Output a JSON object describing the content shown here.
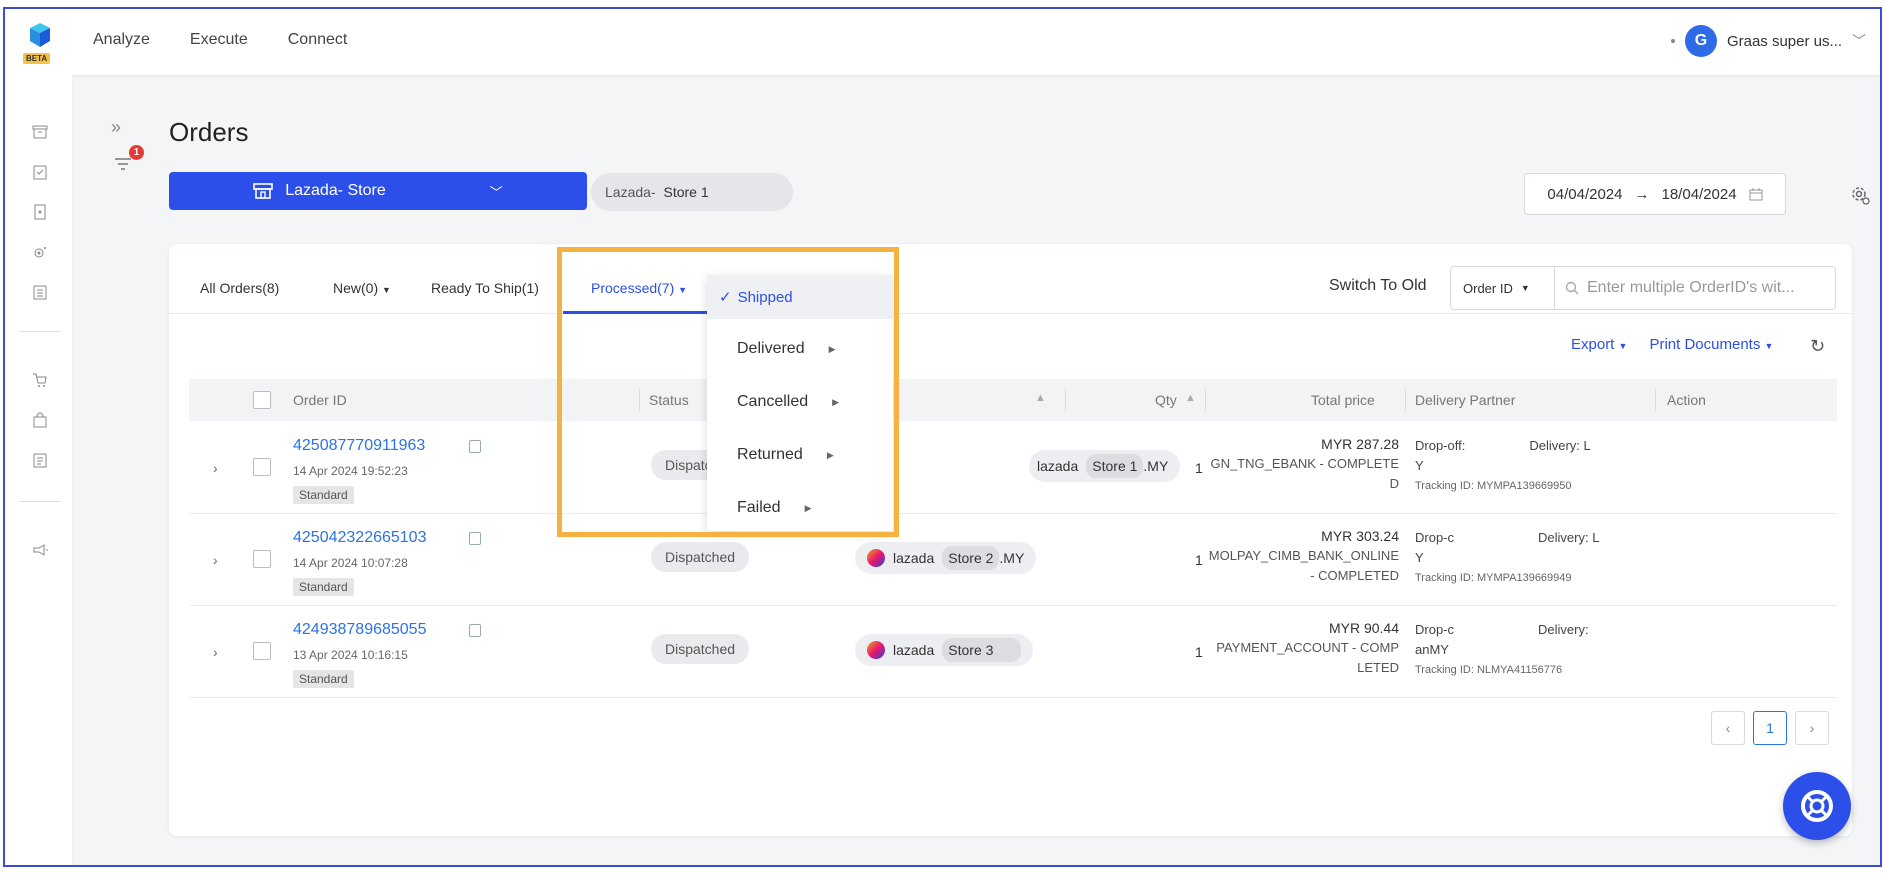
{
  "app": {
    "beta_label": "BETA"
  },
  "topnav": {
    "items": [
      "Analyze",
      "Execute",
      "Connect"
    ]
  },
  "user": {
    "avatar_initial": "G",
    "name": "Graas super us..."
  },
  "page": {
    "title": "Orders"
  },
  "filter": {
    "badge_count": "1"
  },
  "store_selector": {
    "label": "Lazada- Store",
    "chip_label": "Lazada-",
    "chip_store": "Store 1"
  },
  "date_range": {
    "start": "04/04/2024",
    "arrow": "→",
    "end": "18/04/2024"
  },
  "tabs": [
    {
      "label": "All Orders(8)"
    },
    {
      "label": "New(0)"
    },
    {
      "label": "Ready To Ship(1)"
    },
    {
      "label": "Processed(7)"
    }
  ],
  "processed_dropdown": {
    "items": [
      "Shipped",
      "Delivered",
      "Cancelled",
      "Returned",
      "Failed"
    ],
    "selected": "Shipped"
  },
  "toolbar": {
    "switch_old": "Switch To Old",
    "search_type": "Order ID",
    "search_placeholder": "Enter multiple OrderID's wit...",
    "export": "Export",
    "print": "Print Documents"
  },
  "table": {
    "headers": {
      "order_id": "Order ID",
      "status": "Status",
      "qty": "Qty",
      "total_price": "Total price",
      "delivery_partner": "Delivery Partner",
      "action": "Action"
    },
    "rows": [
      {
        "order_id": "425087770911963",
        "date": "14 Apr 2024 19:52:23",
        "type": "Standard",
        "status": "Dispatc",
        "store_prefix": "lazada",
        "store_name": "Store 1",
        "store_suffix": ".MY",
        "qty": "1",
        "amount": "MYR 287.28",
        "payment_line1": "GN_TNG_EBANK - COMPLETE",
        "payment_line2": "D",
        "dp_line1": "Drop-off:",
        "dp_line1b": "Delivery: L",
        "dp_line2": "Y",
        "tracking": "Tracking ID: MYMPA139669950"
      },
      {
        "order_id": "425042322665103",
        "date": "14 Apr 2024 10:07:28",
        "type": "Standard",
        "status": "Dispatched",
        "store_prefix": "lazada",
        "store_name": "Store 2",
        "store_suffix": ".MY",
        "qty": "1",
        "amount": "MYR 303.24",
        "payment_line1": "MOLPAY_CIMB_BANK_ONLINE",
        "payment_line2": "- COMPLETED",
        "dp_line1": "Drop-c",
        "dp_line1b": "Delivery: L",
        "dp_line2": "Y",
        "tracking": "Tracking ID: MYMPA139669949"
      },
      {
        "order_id": "424938789685055",
        "date": "13 Apr 2024 10:16:15",
        "type": "Standard",
        "status": "Dispatched",
        "store_prefix": "lazada",
        "store_name": "Store 3",
        "store_suffix": "",
        "qty": "1",
        "amount": "MYR 90.44",
        "payment_line1": "PAYMENT_ACCOUNT - COMP",
        "payment_line2": "LETED",
        "dp_line1": "Drop-c",
        "dp_line1b": "Delivery:",
        "dp_line2": "anMY",
        "tracking": "Tracking ID: NLMYA41156776"
      }
    ]
  },
  "pagination": {
    "current": "1"
  },
  "colors": {
    "primary": "#2b4fe8",
    "highlight": "#f6b140",
    "badge": "#e53935",
    "link": "#2b73e3"
  }
}
